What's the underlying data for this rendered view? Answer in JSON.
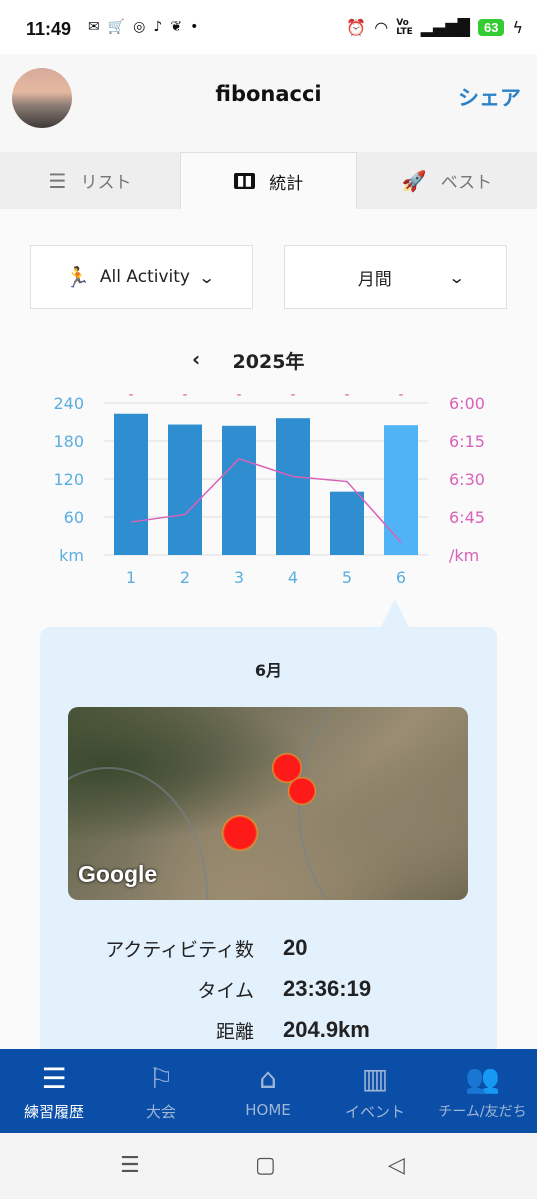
{
  "status_bar": {
    "time": "11:49",
    "left_icons": [
      "mail-icon",
      "cart-icon",
      "instagram-icon",
      "tiktok-icon",
      "bird-icon",
      "dot-icon"
    ],
    "right_icons": [
      "alarm-icon",
      "wifi-icon",
      "volte-icon",
      "signal-icon",
      "charging-icon"
    ],
    "battery": "63",
    "battery_color": "#33cc33"
  },
  "header": {
    "title": "fibonacci",
    "share_label": "シェア",
    "accent_color": "#2b82c9"
  },
  "tabs": [
    {
      "label": "リスト",
      "icon": "list-icon",
      "active": false
    },
    {
      "label": "統計",
      "icon": "bar-chart-icon",
      "active": true
    },
    {
      "label": "ベスト",
      "icon": "rocket-icon",
      "active": false
    }
  ],
  "filters": {
    "activity": "All Activity",
    "period": "月間"
  },
  "year_nav": {
    "prev": "‹",
    "year": "2025年"
  },
  "chart_data": {
    "type": "bar",
    "categories": [
      "1",
      "2",
      "3",
      "4",
      "5",
      "6"
    ],
    "series": [
      {
        "values": [
          223,
          206,
          204,
          216,
          100,
          204.9
        ],
        "axis": "left"
      },
      {
        "values": [
          "6:47",
          "6:44",
          "6:22",
          "6:29",
          "6:31",
          "6:55"
        ],
        "axis": "right"
      }
    ],
    "left_ticks": [
      "240",
      "180",
      "120",
      "60",
      "km"
    ],
    "right_ticks": [
      "6:00",
      "6:15",
      "6:30",
      "6:45",
      "/km"
    ],
    "right_tick_seconds": [
      360,
      375,
      390,
      405
    ],
    "ylim_left": [
      0,
      240
    ],
    "ylim_right_seconds": [
      360,
      420
    ],
    "top_markers": [
      "-",
      "-",
      "-",
      "-",
      "-",
      "-"
    ],
    "selected_index": 5,
    "bar_color": "#2f8ed0",
    "selected_bar_color": "#4fb3f5",
    "line_color": "#d862b8",
    "left_axis_color": "#5aaee0",
    "right_axis_color": "#d862b8"
  },
  "detail": {
    "month": "6月",
    "map_attribution": "Google",
    "stats": [
      {
        "label": "アクティビティ数",
        "value": "20"
      },
      {
        "label": "タイム",
        "value": "23:36:19"
      },
      {
        "label": "距離",
        "value": "204.9km"
      }
    ]
  },
  "bottom_nav": [
    {
      "label": "練習履歴",
      "icon": "list-icon",
      "active": true
    },
    {
      "label": "大会",
      "icon": "flag-icon",
      "active": false
    },
    {
      "label": "HOME",
      "icon": "home-icon",
      "active": false
    },
    {
      "label": "イベント",
      "icon": "map-icon",
      "active": false
    },
    {
      "label": "チーム/友だち",
      "icon": "people-icon",
      "active": false
    }
  ],
  "android_nav": [
    "recents-icon",
    "home-circle-icon",
    "back-icon"
  ]
}
